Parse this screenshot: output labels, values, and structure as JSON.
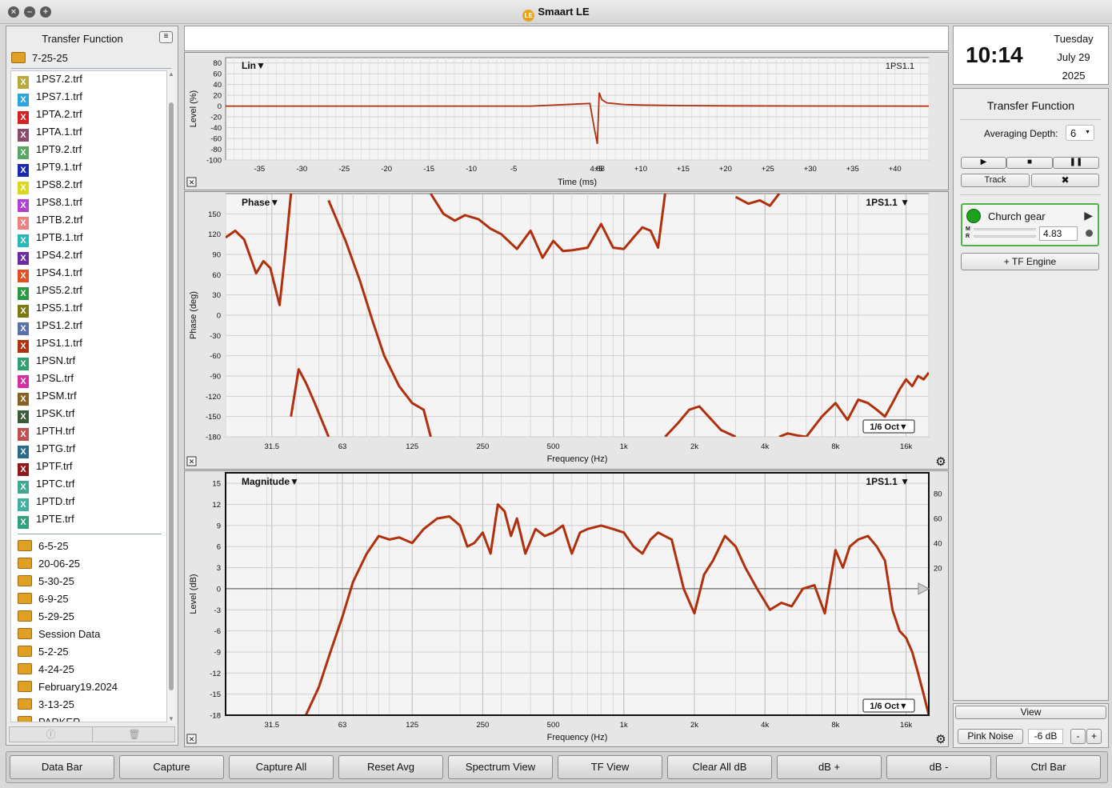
{
  "window": {
    "title": "Smaart LE",
    "logo_text": "LE"
  },
  "left_panel": {
    "title": "Transfer Function",
    "current_folder": "7-25-25",
    "files": [
      {
        "name": "1PS7.2.trf",
        "color": "#b8a83a"
      },
      {
        "name": "1PS7.1.trf",
        "color": "#2aa5e0"
      },
      {
        "name": "1PTA.2.trf",
        "color": "#d42020"
      },
      {
        "name": "1PTA.1.trf",
        "color": "#8a4a6a"
      },
      {
        "name": "1PT9.2.trf",
        "color": "#5aa560"
      },
      {
        "name": "1PT9.1.trf",
        "color": "#1a2ab0"
      },
      {
        "name": "1PS8.2.trf",
        "color": "#d8d820"
      },
      {
        "name": "1PS8.1.trf",
        "color": "#b040d0"
      },
      {
        "name": "1PTB.2.trf",
        "color": "#f08080"
      },
      {
        "name": "1PTB.1.trf",
        "color": "#28b8b8"
      },
      {
        "name": "1PS4.2.trf",
        "color": "#6a2aa0"
      },
      {
        "name": "1PS4.1.trf",
        "color": "#e05020"
      },
      {
        "name": "1PS5.2.trf",
        "color": "#2a9a40"
      },
      {
        "name": "1PS5.1.trf",
        "color": "#7a7a10"
      },
      {
        "name": "1PS1.2.trf",
        "color": "#5a70a8"
      },
      {
        "name": "1PS1.1.trf",
        "color": "#b03010"
      },
      {
        "name": "1PSN.trf",
        "color": "#30a070"
      },
      {
        "name": "1PSL.trf",
        "color": "#d030a0"
      },
      {
        "name": "1PSM.trf",
        "color": "#8a6020"
      },
      {
        "name": "1PSK.trf",
        "color": "#3a5a3a"
      },
      {
        "name": "1PTH.trf",
        "color": "#c05050"
      },
      {
        "name": "1PTG.trf",
        "color": "#2a6a8a"
      },
      {
        "name": "1PTF.trf",
        "color": "#901818"
      },
      {
        "name": "1PTC.trf",
        "color": "#40a890"
      },
      {
        "name": "1PTD.trf",
        "color": "#40b0a0"
      },
      {
        "name": "1PTE.trf",
        "color": "#30a080"
      }
    ],
    "folders": [
      "6-5-25",
      "20-06-25",
      "5-30-25",
      "6-9-25",
      "5-29-25",
      "Session Data",
      "5-2-25",
      "4-24-25",
      "February19.2024",
      "3-13-25",
      "PARKER"
    ],
    "footer_info_icon": "info-icon",
    "footer_trash_icon": "trash-icon"
  },
  "ir_plot": {
    "mode_label": "Lin",
    "trace_label": "1PS1.1",
    "ylabel": "Level (%)",
    "xlabel": "Time (ms)",
    "y_ticks": [
      "80",
      "60",
      "40",
      "20",
      "0",
      "-20",
      "-40",
      "-60",
      "-80",
      "-100"
    ],
    "x_ticks": [
      "-35",
      "-30",
      "-25",
      "-20",
      "-15",
      "-10",
      "-5",
      "4.88",
      "+5",
      "+10",
      "+15",
      "+20",
      "+25",
      "+30",
      "+35",
      "+40"
    ]
  },
  "phase_plot": {
    "mode_label": "Phase",
    "trace_label": "1PS1.1",
    "ylabel": "Phase (deg)",
    "xlabel": "Frequency (Hz)",
    "smoothing": "1/6 Oct",
    "y_ticks": [
      "150",
      "120",
      "90",
      "60",
      "30",
      "0",
      "-30",
      "-60",
      "-90",
      "-120",
      "-150",
      "-180"
    ],
    "x_ticks": [
      "31.5",
      "63",
      "125",
      "250",
      "500",
      "1k",
      "2k",
      "4k",
      "8k",
      "16k"
    ]
  },
  "mag_plot": {
    "mode_label": "Magnitude",
    "trace_label": "1PS1.1",
    "ylabel": "Level (dB)",
    "xlabel": "Frequency (Hz)",
    "smoothing": "1/6 Oct",
    "y_ticks": [
      "15",
      "12",
      "9",
      "6",
      "3",
      "0",
      "-3",
      "-6",
      "-9",
      "-12",
      "-15",
      "-18"
    ],
    "right_ticks": [
      "80",
      "60",
      "40",
      "20"
    ],
    "x_ticks": [
      "31.5",
      "63",
      "125",
      "250",
      "500",
      "1k",
      "2k",
      "4k",
      "8k",
      "16k"
    ]
  },
  "clock": {
    "time": "10:14",
    "weekday": "Tuesday",
    "date": "July 29",
    "year": "2025"
  },
  "tf_panel": {
    "title": "Transfer Function",
    "averaging_label": "Averaging Depth:",
    "averaging_value": "6",
    "track_label": "Track",
    "engine_name": "Church gear",
    "delay_value": "4.83",
    "meter_m": "M",
    "meter_r": "R",
    "add_engine_label": "+ TF Engine",
    "view_label": "View",
    "pink_noise_label": "Pink Noise",
    "noise_level": "-6 dB",
    "minus": "-",
    "plus": "+"
  },
  "bottom_bar": [
    "Data Bar",
    "Capture",
    "Capture All",
    "Reset Avg",
    "Spectrum View",
    "TF View",
    "Clear All dB",
    "dB +",
    "dB -",
    "Ctrl Bar"
  ],
  "chart_data": [
    {
      "type": "line",
      "title": "Lin",
      "xlabel": "Time (ms)",
      "ylabel": "Level (%)",
      "xlim": [
        -39,
        44
      ],
      "ylim": [
        -100,
        90
      ],
      "series": [
        {
          "name": "1PS1.1",
          "x": [
            -39,
            -20,
            -10,
            -3,
            4.0,
            4.5,
            4.88,
            5.1,
            5.4,
            6,
            8,
            10,
            15,
            20,
            30,
            44
          ],
          "y": [
            0,
            0,
            0,
            0,
            5,
            -40,
            -70,
            25,
            12,
            6,
            3,
            2,
            1,
            0.5,
            0.2,
            0
          ]
        }
      ]
    },
    {
      "type": "line",
      "title": "Phase",
      "xlabel": "Frequency (Hz)",
      "ylabel": "Phase (deg)",
      "xscale": "log",
      "xlim": [
        20,
        20000
      ],
      "ylim": [
        -180,
        180
      ],
      "series": [
        {
          "name": "1PS1.1",
          "segments": [
            {
              "x": [
                20,
                22,
                24,
                27,
                29,
                31,
                34,
                36,
                38
              ],
              "y": [
                115,
                125,
                112,
                62,
                80,
                70,
                15,
                95,
                180
              ]
            },
            {
              "x": [
                38,
                41,
                44,
                48,
                55
              ],
              "y": [
                -150,
                -80,
                -100,
                -130,
                -180
              ]
            },
            {
              "x": [
                55,
                65,
                75,
                85,
                95,
                110,
                125,
                140,
                150
              ],
              "y": [
                170,
                110,
                50,
                -10,
                -60,
                -105,
                -130,
                -140,
                -180
              ]
            },
            {
              "x": [
                150,
                170,
                190,
                210,
                240,
                270,
                300,
                350,
                400,
                450,
                500,
                550,
                600,
                700,
                800,
                900,
                1000,
                1100,
                1200,
                1300,
                1400,
                1500
              ],
              "y": [
                180,
                150,
                140,
                148,
                142,
                128,
                120,
                98,
                125,
                85,
                110,
                95,
                96,
                100,
                135,
                100,
                98,
                115,
                130,
                125,
                100,
                180
              ]
            },
            {
              "x": [
                1500,
                1700,
                1900,
                2100,
                2300,
                2600,
                3000
              ],
              "y": [
                -180,
                -160,
                -140,
                -135,
                -150,
                -170,
                -180
              ]
            },
            {
              "x": [
                3000,
                3400,
                3800,
                4200,
                4600
              ],
              "y": [
                175,
                165,
                170,
                162,
                180
              ]
            },
            {
              "x": [
                4600,
                5000,
                5500,
                6000
              ],
              "y": [
                -180,
                -175,
                -178,
                -180
              ]
            },
            {
              "x": [
                6000,
                7000,
                8000,
                9000,
                10000,
                11000,
                12000,
                13000,
                14000,
                15000,
                16000,
                17000,
                18000,
                19000,
                20000
              ],
              "y": [
                -180,
                -150,
                -130,
                -155,
                -125,
                -130,
                -140,
                -150,
                -130,
                -110,
                -95,
                -105,
                -90,
                -95,
                -85
              ]
            }
          ]
        }
      ]
    },
    {
      "type": "line",
      "title": "Magnitude",
      "xlabel": "Frequency (Hz)",
      "ylabel": "Level (dB)",
      "xscale": "log",
      "xlim": [
        20,
        20000
      ],
      "ylim": [
        -18,
        16.5
      ],
      "series": [
        {
          "name": "1PS1.1",
          "x": [
            44,
            50,
            56,
            63,
            70,
            80,
            90,
            100,
            110,
            125,
            140,
            160,
            180,
            200,
            215,
            230,
            250,
            270,
            290,
            310,
            330,
            350,
            380,
            420,
            460,
            500,
            550,
            600,
            650,
            700,
            800,
            900,
            1000,
            1100,
            1200,
            1300,
            1400,
            1600,
            1800,
            2000,
            2200,
            2400,
            2700,
            3000,
            3300,
            3700,
            4200,
            4700,
            5200,
            5800,
            6500,
            7200,
            8000,
            8600,
            9200,
            10000,
            11000,
            12000,
            13000,
            14000,
            15000,
            16000,
            17000,
            18000,
            19000,
            20000
          ],
          "y": [
            -18,
            -14,
            -9,
            -4,
            1,
            5,
            7.5,
            7,
            7.3,
            6.5,
            8.5,
            10,
            10.3,
            9,
            6,
            6.5,
            8,
            5,
            12,
            11,
            7.5,
            10,
            5,
            8.5,
            7.5,
            8,
            9,
            5,
            8,
            8.5,
            9,
            8.5,
            8,
            6,
            5,
            7,
            8,
            7,
            0,
            -3.5,
            2,
            4,
            7.5,
            6,
            3,
            0,
            -3,
            -2,
            -2.5,
            0,
            0.5,
            -3.5,
            5.5,
            3,
            6,
            7,
            7.5,
            6,
            4,
            -3,
            -6,
            -7,
            -9,
            -12,
            -15,
            -18
          ]
        }
      ]
    }
  ]
}
